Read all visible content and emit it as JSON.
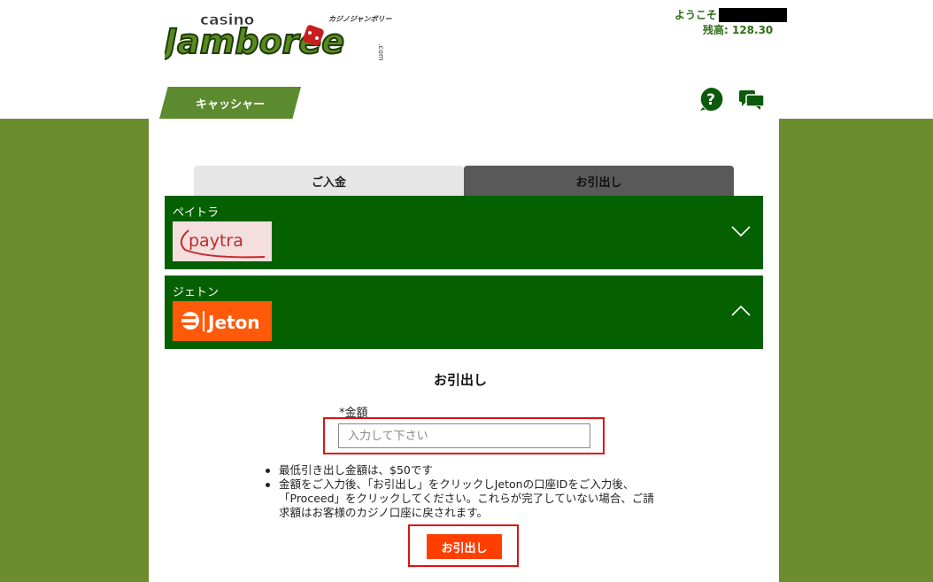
{
  "header": {
    "logo_alt": "casino Jamboree",
    "logo_small_text": "casino",
    "logo_main_text": "Jamboree",
    "logo_kana": "カジノジャンボリー",
    "logo_com": ".com",
    "welcome_label": "ようこそ",
    "balance_text": "残高: 128.30",
    "cashier_label": "キャッシャー"
  },
  "tabs": {
    "deposit_label": "ご入金",
    "withdraw_label": "お引出し"
  },
  "methods": [
    {
      "label": "ペイトラ",
      "logo_text": "paytra",
      "expanded": false
    },
    {
      "label": "ジェトン",
      "logo_text": "Jeton",
      "expanded": true
    }
  ],
  "form": {
    "title": "お引出し",
    "amount_label": "*金額",
    "amount_value": "",
    "amount_placeholder": "入力して下さい",
    "notes": [
      "最低引き出し金額は、$50です",
      "金額をご入力後、「お引出し」をクリックしJetonの口座IDをご入力後、「Proceed」をクリックしてください。これらが完了していない場合、ご請求額はお客様のカジノ口座に戻されます。"
    ],
    "submit_label": "お引出し"
  },
  "colors": {
    "page_green": "#6b8c2f",
    "method_green": "#056100",
    "accent_orange": "#ff3e00",
    "highlight_red": "#e01010",
    "jeton_orange": "#ff5a0a"
  }
}
